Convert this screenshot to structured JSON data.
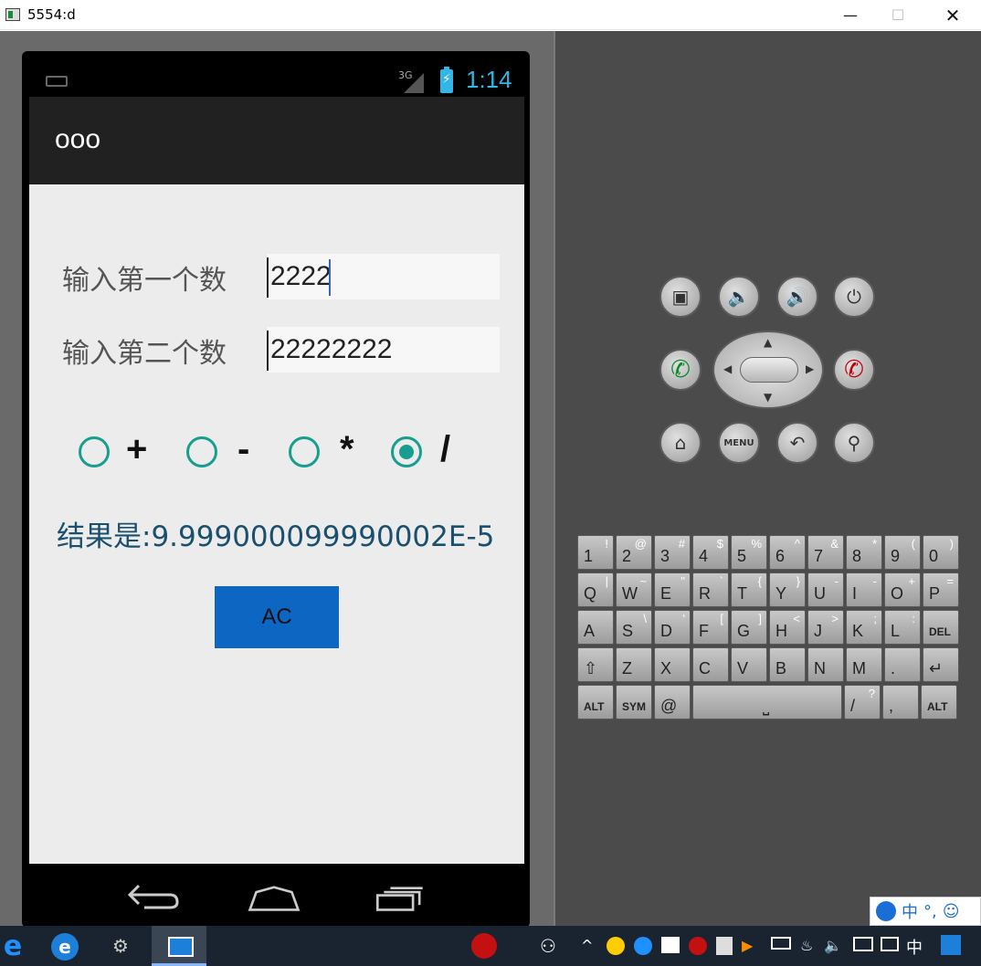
{
  "window": {
    "title": "5554:d",
    "minimize": "—",
    "maximize": "☐",
    "close": "✕"
  },
  "statusbar": {
    "network": "3G",
    "time": "1:14",
    "battery_glyph": "⚡"
  },
  "app": {
    "title": "ooo",
    "first_label": "输入第一个数",
    "first_value": "2222",
    "second_label": "输入第二个数",
    "second_value": "22222222",
    "operators": [
      {
        "label": "+",
        "checked": false
      },
      {
        "label": "-",
        "checked": false
      },
      {
        "label": "*",
        "checked": false
      },
      {
        "label": "/",
        "checked": true
      }
    ],
    "result": "结果是:9.999000099990002E-5",
    "ac_label": "AC"
  },
  "navbar": {
    "back_icon": "back-icon",
    "home_icon": "home-icon",
    "recent_icon": "recent-apps-icon"
  },
  "hardware_buttons": {
    "menu_label": "MENU"
  },
  "keyboard": {
    "rows": [
      [
        [
          "1",
          "!"
        ],
        [
          "2",
          "@"
        ],
        [
          "3",
          "#"
        ],
        [
          "4",
          "$"
        ],
        [
          "5",
          "%"
        ],
        [
          "6",
          "^"
        ],
        [
          "7",
          "&"
        ],
        [
          "8",
          "*"
        ],
        [
          "9",
          "("
        ],
        [
          "0",
          ")"
        ]
      ],
      [
        [
          "Q",
          "|"
        ],
        [
          "W",
          "~"
        ],
        [
          "E",
          "\""
        ],
        [
          "R",
          "`"
        ],
        [
          "T",
          "{"
        ],
        [
          "Y",
          "}"
        ],
        [
          "U",
          "-"
        ],
        [
          "I",
          "-"
        ],
        [
          "O",
          "+"
        ],
        [
          "P",
          "="
        ]
      ],
      [
        [
          "A",
          ""
        ],
        [
          "S",
          "\\"
        ],
        [
          "D",
          "'"
        ],
        [
          "F",
          "["
        ],
        [
          "G",
          "]"
        ],
        [
          "H",
          "<"
        ],
        [
          "J",
          ">"
        ],
        [
          "K",
          ";"
        ],
        [
          "L",
          ":"
        ],
        [
          "DEL",
          ""
        ]
      ],
      [
        [
          "⇧",
          ""
        ],
        [
          "Z",
          ""
        ],
        [
          "X",
          ""
        ],
        [
          "C",
          ""
        ],
        [
          "V",
          ""
        ],
        [
          "B",
          ""
        ],
        [
          "N",
          ""
        ],
        [
          "M",
          ""
        ],
        [
          ".",
          ""
        ],
        [
          "↵",
          ""
        ]
      ]
    ],
    "bottom": {
      "alt_left": "ALT",
      "sym": "SYM",
      "at": "@",
      "space": "⎵",
      "slash": "/",
      "question": "?",
      "comma": ",",
      "alt_right": "ALT"
    }
  },
  "ime": {
    "lang": "中",
    "punct": "°,",
    "emoji": "☺"
  },
  "taskbar": {
    "ime_lang": "中",
    "edge_glyph": "e",
    "ie_glyph": "e",
    "gear_glyph": "⚙",
    "people_glyph": "⚇",
    "tray_up": "^",
    "tray_volume": "🔈",
    "tray_input": "中"
  }
}
